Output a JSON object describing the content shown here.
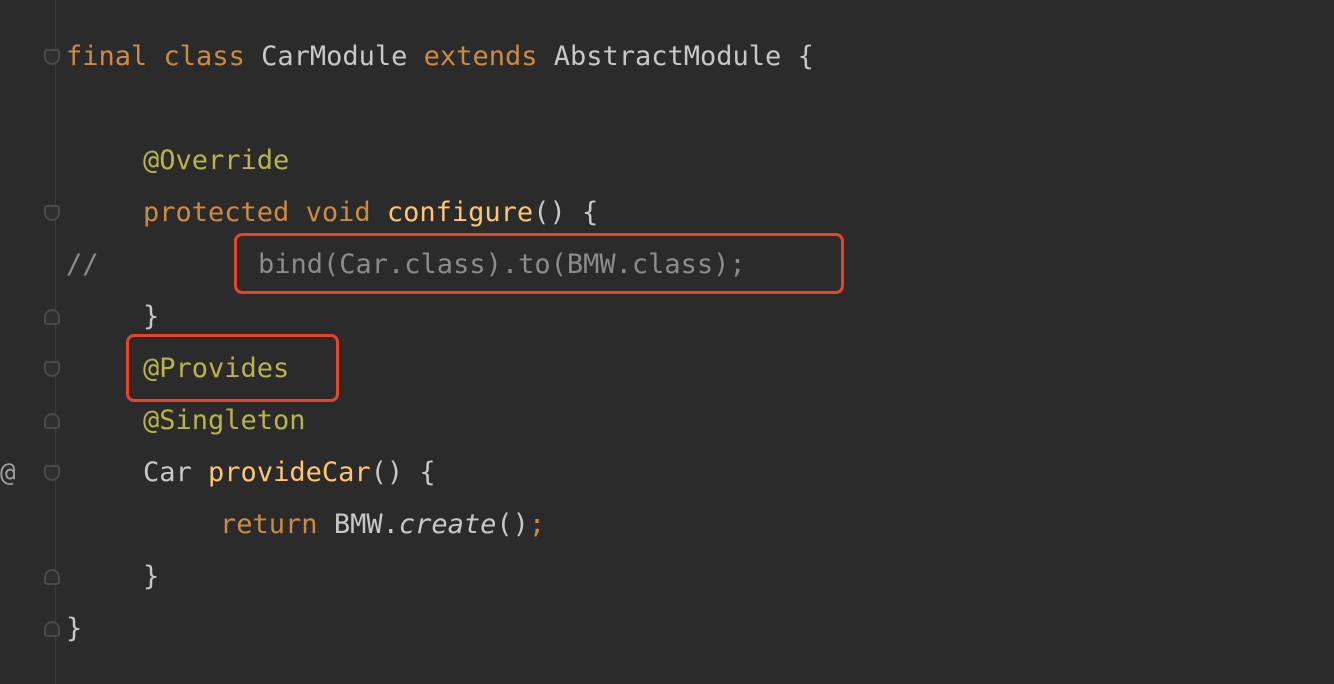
{
  "code": {
    "line1": {
      "kw1": "final",
      "kw2": "class",
      "name": "CarModule",
      "kw3": "extends",
      "parent": "AbstractModule",
      "brace": "{"
    },
    "line3": {
      "ann": "@Override"
    },
    "line4": {
      "kw1": "protected",
      "kw2": "void",
      "fn": "configure",
      "rest": "() {"
    },
    "line5": {
      "comment_marker": "//",
      "body": "bind(Car.class).to(BMW.class);"
    },
    "line6": {
      "brace": "}"
    },
    "line7": {
      "ann": "@Provides"
    },
    "line8": {
      "ann": "@Singleton"
    },
    "line9": {
      "type": "Car",
      "fn": "provideCar",
      "rest": "() {"
    },
    "line10": {
      "kw": "return",
      "obj": "BMW.",
      "method": "create",
      "rest": "()",
      "semi": ";"
    },
    "line11": {
      "brace": "}"
    },
    "line12": {
      "brace": "}"
    }
  },
  "gutter": {
    "implements_marker": "@"
  },
  "colors": {
    "background": "#2b2b2c",
    "keyword": "#cc8b42",
    "annotation": "#b8b445",
    "function": "#ffc66d",
    "comment": "#8c8c8c",
    "highlight_box": "#e8442c"
  }
}
